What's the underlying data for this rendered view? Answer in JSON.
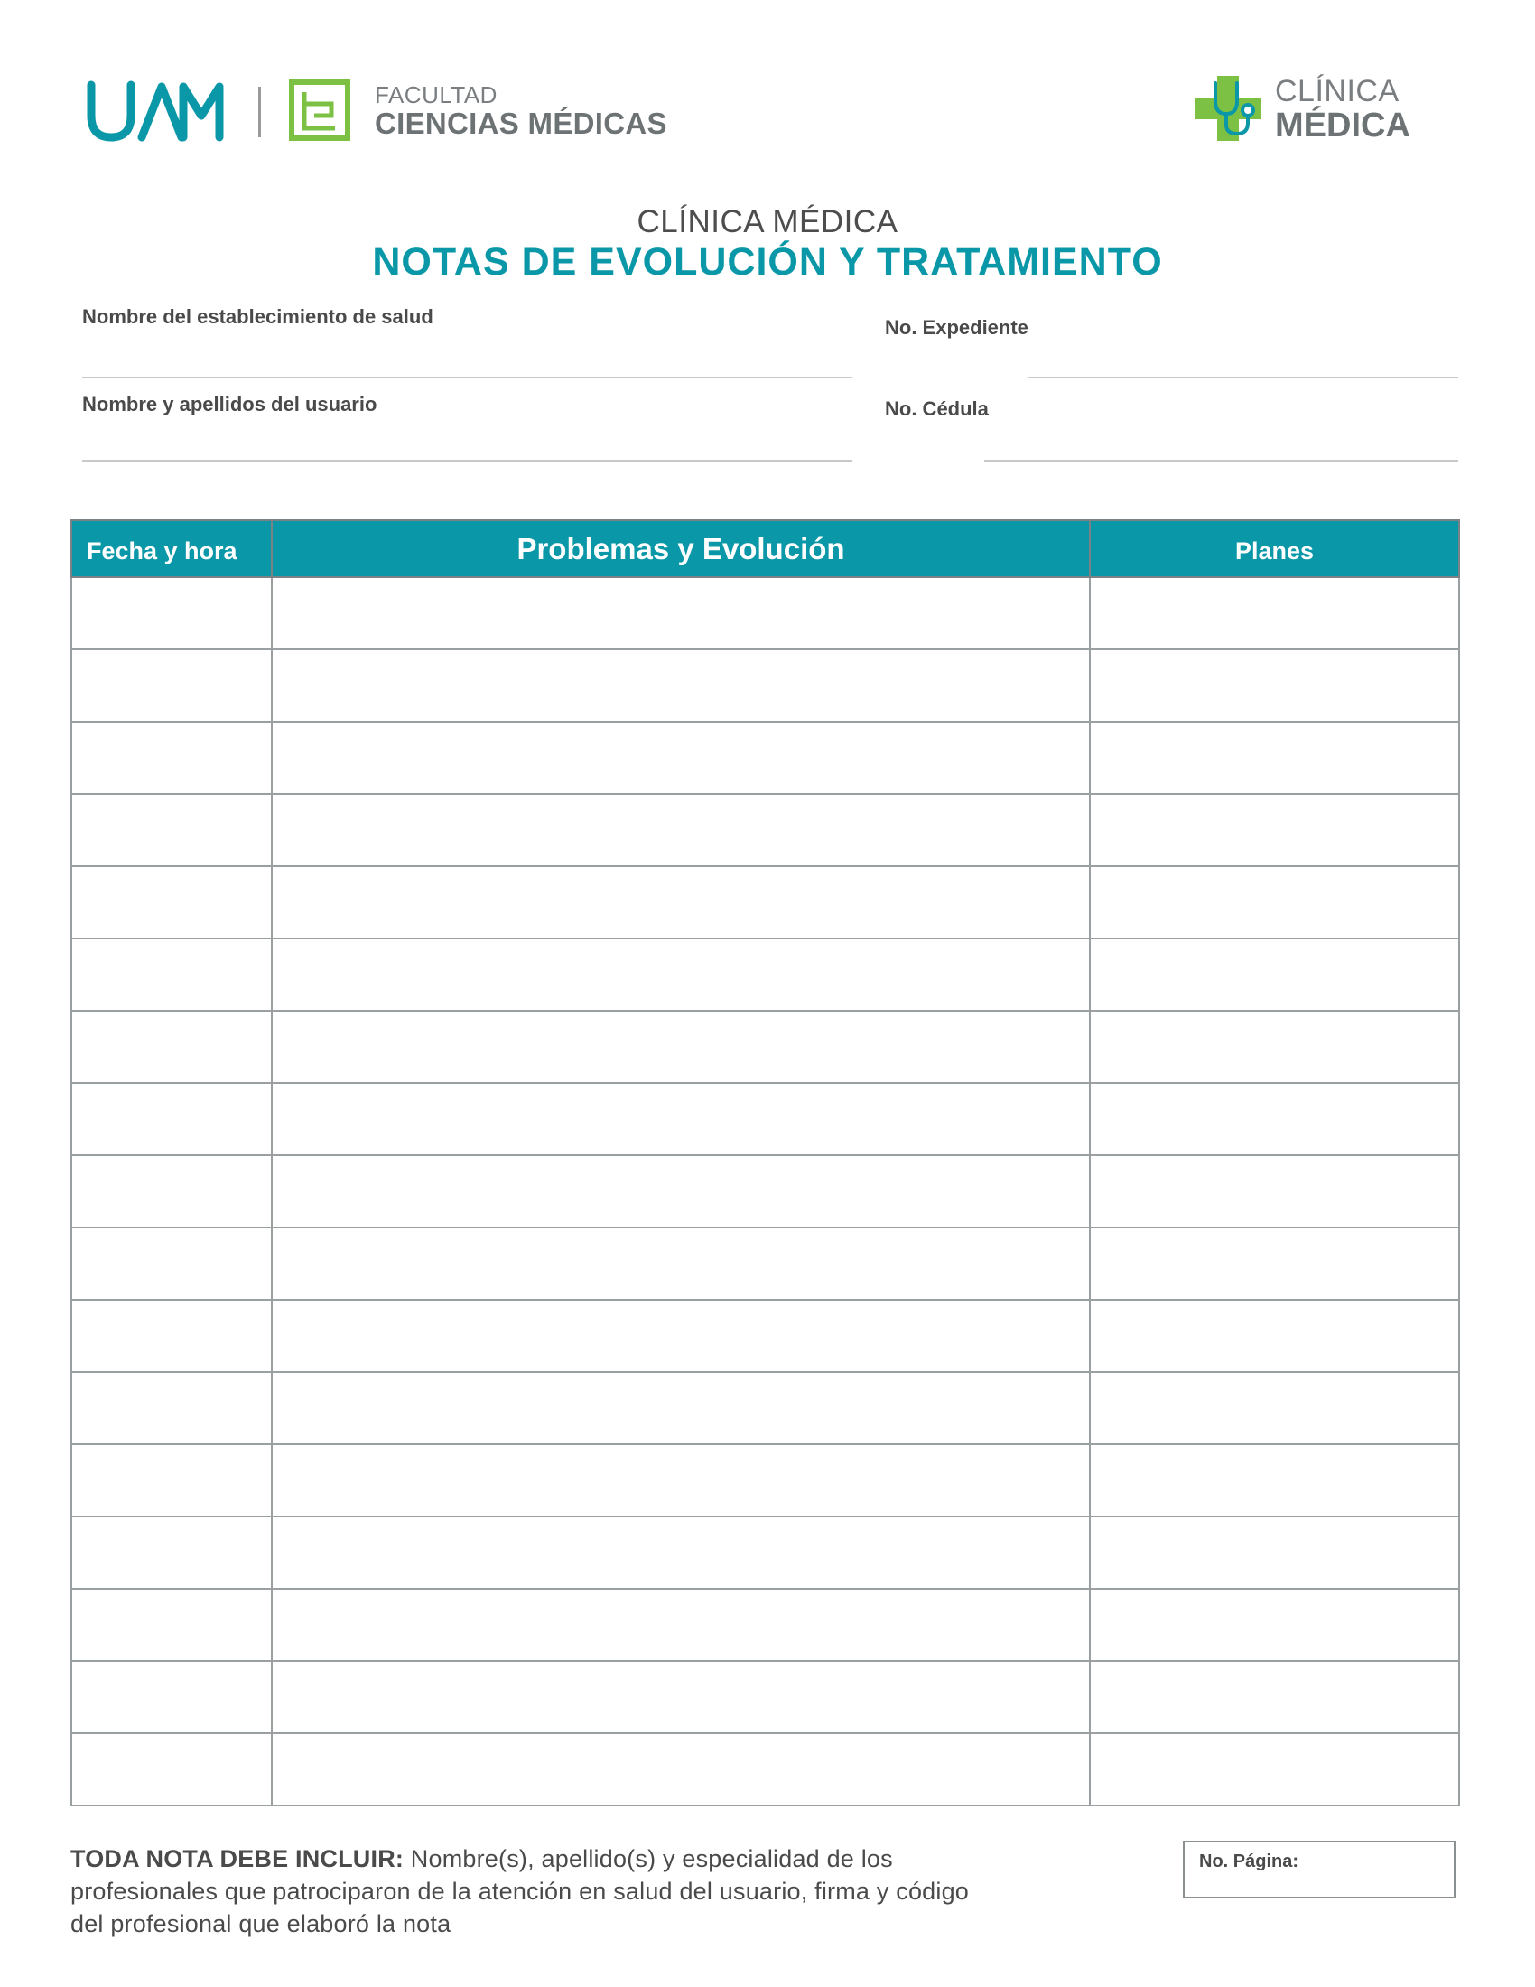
{
  "header": {
    "uam_logo_text": "UAM",
    "faculty_line1": "FACULTAD",
    "faculty_line2": "CIENCIAS MÉDICAS",
    "clinic_line1": "CLÍNICA",
    "clinic_line2": "MÉDICA",
    "brand_teal": "#0a98a8",
    "brand_green": "#7cc143"
  },
  "title": {
    "top": "CLÍNICA MÉDICA",
    "main": "NOTAS DE EVOLUCIÓN Y TRATAMIENTO"
  },
  "fields": {
    "establishment_label": "Nombre del establecimiento de salud",
    "expediente_label": "No. Expediente",
    "user_name_label": "Nombre y apellidos del usuario",
    "cedula_label": "No. Cédula"
  },
  "table": {
    "columns": [
      "Fecha y hora",
      "Problemas y Evolución",
      "Planes"
    ],
    "row_count": 17
  },
  "footer": {
    "note_bold": "TODA NOTA DEBE INCLUIR:",
    "note_text": " Nombre(s), apellido(s) y especialidad de los profesionales que patrociparon de la atención en salud del usuario, firma y código del profesional que elaboró la nota",
    "page_label": "No. Página:"
  }
}
